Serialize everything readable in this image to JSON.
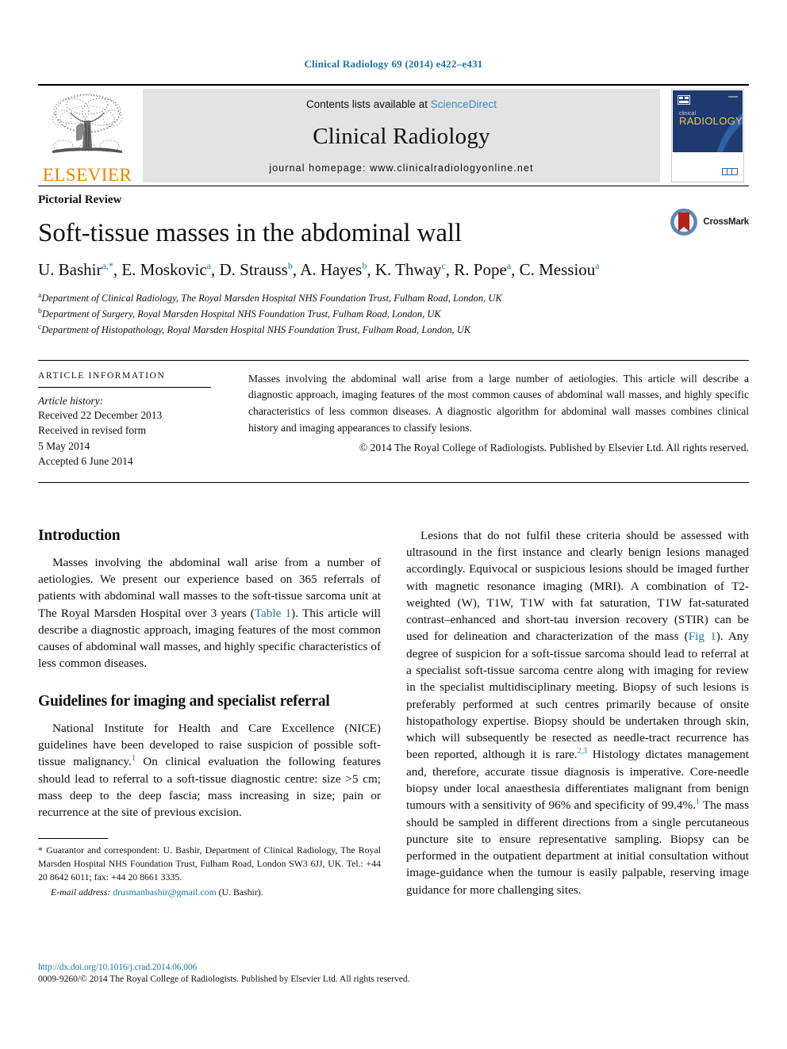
{
  "running_head": "Clinical Radiology 69 (2014) e422–e431",
  "masthead": {
    "publisher_name": "ELSEVIER",
    "contents_prefix": "Contents lists available at ",
    "sciencedirect": "ScienceDirect",
    "journal_name": "Clinical Radiology",
    "homepage": "journal homepage: www.clinicalradiologyonline.net",
    "cover": {
      "title_small": "clinical",
      "title_large": "RADIOLOGY"
    }
  },
  "article": {
    "doctype": "Pictorial Review",
    "title": "Soft-tissue masses in the abdominal wall",
    "crossmark_label": "CrossMark",
    "authors": [
      {
        "name": "U. Bashir",
        "marks": "a,*"
      },
      {
        "name": "E. Moskovic",
        "marks": "a"
      },
      {
        "name": "D. Strauss",
        "marks": "b"
      },
      {
        "name": "A. Hayes",
        "marks": "b"
      },
      {
        "name": "K. Thway",
        "marks": "c"
      },
      {
        "name": "R. Pope",
        "marks": "a"
      },
      {
        "name": "C. Messiou",
        "marks": "a"
      }
    ],
    "affiliations": [
      {
        "mark": "a",
        "text": "Department of Clinical Radiology, The Royal Marsden Hospital NHS Foundation Trust, Fulham Road, London, UK"
      },
      {
        "mark": "b",
        "text": "Department of Surgery, Royal Marsden Hospital NHS Foundation Trust, Fulham Road, London, UK"
      },
      {
        "mark": "c",
        "text": "Department of Histopathology, Royal Marsden Hospital NHS Foundation Trust, Fulham Road, London, UK"
      }
    ]
  },
  "article_information": {
    "heading": "ARTICLE INFORMATION",
    "history_label": "Article history:",
    "history": [
      "Received 22 December 2013",
      "Received in revised form",
      "5 May 2014",
      "Accepted 6 June 2014"
    ],
    "abstract": "Masses involving the abdominal wall arise from a large number of aetiologies. This article will describe a diagnostic approach, imaging features of the most common causes of abdominal wall masses, and highly specific characteristics of less common diseases. A diagnostic algorithm for abdominal wall masses combines clinical history and imaging appearances to classify lesions.",
    "copyright": "© 2014 The Royal College of Radiologists. Published by Elsevier Ltd. All rights reserved."
  },
  "body": {
    "left": {
      "intro_heading": "Introduction",
      "intro_p1_a": "Masses involving the abdominal wall arise from a number of aetiologies. We present our experience based on 365 referrals of patients with abdominal wall masses to the soft-tissue sarcoma unit at The Royal Marsden Hospital over 3 years (",
      "intro_p1_link": "Table 1",
      "intro_p1_b": "). This article will describe a diagnostic approach, imaging features of the most common causes of abdominal wall masses, and highly specific characteristics of less common diseases.",
      "guidelines_heading": "Guidelines for imaging and specialist referral",
      "guidelines_p1_a": "National Institute for Health and Care Excellence (NICE) guidelines have been developed to raise suspicion of possible soft-tissue malignancy.",
      "guidelines_cite1": "1",
      "guidelines_p1_b": " On clinical evaluation the following features should lead to referral to a soft-tissue diagnostic centre: size >5 cm; mass deep to the deep fascia; mass increasing in size; pain or recurrence at the site of previous excision."
    },
    "right": {
      "p1_a": "Lesions that do not fulfil these criteria should be assessed with ultrasound in the first instance and clearly benign lesions managed accordingly. Equivocal or suspicious lesions should be imaged further with magnetic resonance imaging (MRI). A combination of T2-weighted (W), T1W, T1W with fat saturation, T1W fat-saturated contrast–enhanced and short-tau inversion recovery (STIR) can be used for delineation and characterization of the mass (",
      "p1_link1": "Fig 1",
      "p1_b": "). Any degree of suspicion for a soft-tissue sarcoma should lead to referral at a specialist soft-tissue sarcoma centre along with imaging for review in the specialist multidisciplinary meeting. Biopsy of such lesions is preferably performed at such centres primarily because of onsite histopathology expertise. Biopsy should be undertaken through skin, which will subsequently be resected as needle-tract recurrence has been reported, although it is rare.",
      "p1_cite1": "2,3",
      "p1_c": " Histology dictates management and, therefore, accurate tissue diagnosis is imperative. Core-needle biopsy under local anaesthesia differentiates malignant from benign tumours with a sensitivity of 96% and specificity of 99.4%.",
      "p1_cite2": "1",
      "p1_d": " The mass should be sampled in different directions from a single percutaneous puncture site to ensure representative sampling. Biopsy can be performed in the outpatient department at initial consultation without image-guidance when the tumour is easily palpable, reserving image guidance for more challenging sites."
    }
  },
  "footnote": {
    "star": "*",
    "correspondence": " Guarantor and correspondent: U. Bashir, Department of Clinical Radiology, The Royal Marsden Hospital NHS Foundation Trust, Fulham Road, London SW3 6JJ, UK. Tel.: +44 20 8642 6011; fax: +44 20 8661 3335.",
    "email_label": "E-mail address:",
    "email": "drusmanbashir@gmail.com",
    "email_suffix": " (U. Bashir)."
  },
  "page_footer": {
    "doi": "http://dx.doi.org/10.1016/j.crad.2014.06.006",
    "issn_line": "0009-9260/© 2014 The Royal College of Radiologists. Published by Elsevier Ltd. All rights reserved."
  },
  "colors": {
    "link_blue": "#1a75a7",
    "sciencedirect_blue": "#3c8dc5",
    "elsevier_orange": "#f08000",
    "band_grey": "#e3e3e3",
    "crossmark_red": "#b32317",
    "crossmark_blue": "#5c86b5",
    "cover_navy": "#1f3a6e"
  }
}
